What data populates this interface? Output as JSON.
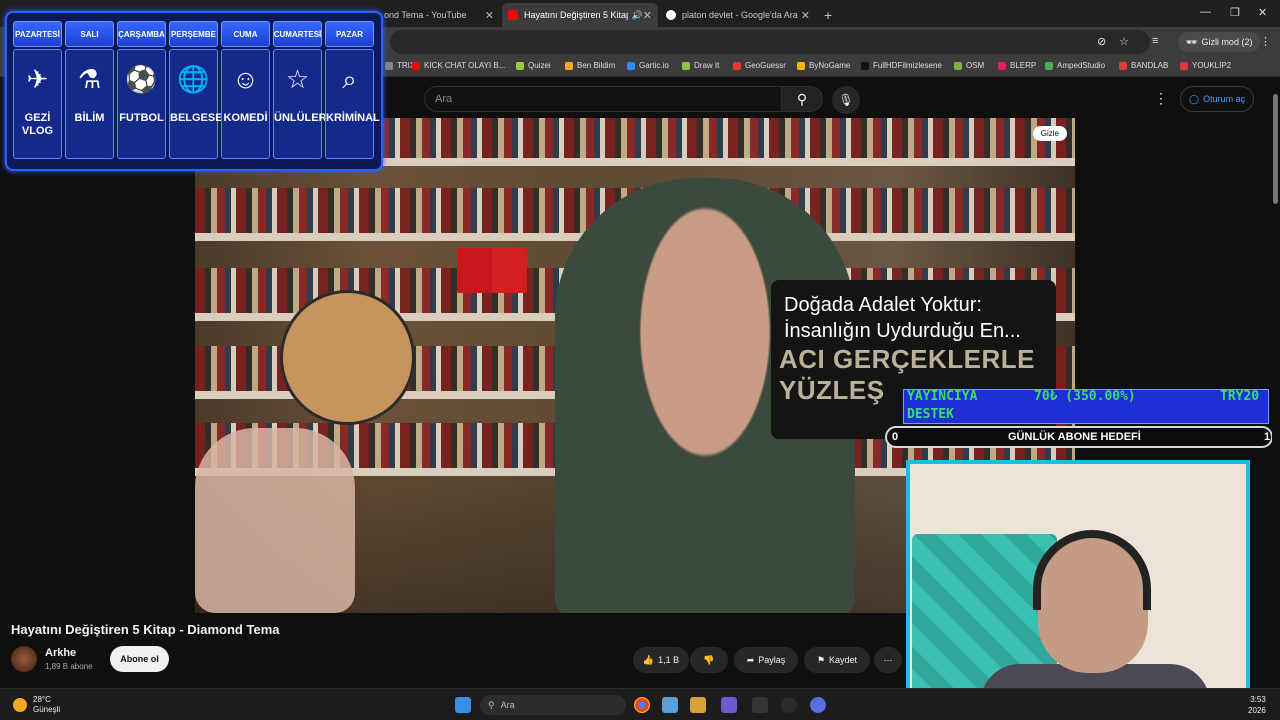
{
  "browser": {
    "tabs": [
      {
        "title": "ond Tema - YouTube",
        "active": false
      },
      {
        "title": "Hayatını Değiştiren 5 Kitap",
        "active": true
      },
      {
        "title": "platon devlet - Google'da Ara",
        "active": false
      }
    ],
    "new_tab_symbol": "+",
    "incognito_label": "Gizli mod (2)",
    "bookmarks": [
      {
        "label": "TRIX",
        "color": "#888888"
      },
      {
        "label": "KICK CHAT OLAYI B...",
        "color": "#ff0000"
      },
      {
        "label": "Quizei",
        "color": "#9acd32"
      },
      {
        "label": "Ben Bildim",
        "color": "#f5a623"
      },
      {
        "label": "Gartic.io",
        "color": "#2d8cff"
      },
      {
        "label": "Draw It",
        "color": "#8bc34a"
      },
      {
        "label": "GeoGuessr",
        "color": "#e53935"
      },
      {
        "label": "ByNoGame",
        "color": "#ffb300"
      },
      {
        "label": "FullHDFilmizlesene",
        "color": "#111111"
      },
      {
        "label": "OSM",
        "color": "#7cb342"
      },
      {
        "label": "BLERP",
        "color": "#e91e63"
      },
      {
        "label": "AmpedStudio",
        "color": "#4caf50"
      },
      {
        "label": "BANDLAB",
        "color": "#e53935"
      },
      {
        "label": "YOUKLİP2",
        "color": "#e53935"
      }
    ]
  },
  "youtube": {
    "search_placeholder": "Ara",
    "signin_label": "Oturum aç",
    "hide_label": "Gizle",
    "video_title": "Hayatını Değiştiren 5 Kitap - Diamond Tema",
    "channel_name": "Arkhe",
    "subscriber_count": "1,89 B abone",
    "subscribe_label": "Abone ol",
    "like_count": "1,1 B",
    "share_label": "Paylaş",
    "save_label": "Kaydet"
  },
  "stream_overlay": {
    "news_title": "Doğada Adalet Yoktur: İnsanlığın Uydurduğu En...",
    "news_subtitle": "ACI GERÇEKLERLE YÜZLEŞ",
    "donation": {
      "label_line1": "YAYINCIYA",
      "label_line2": "DESTEK",
      "amount": "70₺ (350.00%)",
      "goal": "TRY20"
    },
    "sub_goal": {
      "label": "GÜNLÜK ABONE HEDEFİ",
      "current": "0",
      "target": "1"
    },
    "schedule": [
      {
        "day": "PAZARTESİ",
        "topic": "GEZİ VLOG",
        "icon": "globe-plane-icon",
        "glyph": "✈"
      },
      {
        "day": "SALI",
        "topic": "BİLİM",
        "icon": "science-icon",
        "glyph": "⚗"
      },
      {
        "day": "ÇARŞAMBA",
        "topic": "FUTBOL",
        "icon": "football-icon",
        "glyph": "⚽"
      },
      {
        "day": "PERŞEMBE",
        "topic": "BELGESEL",
        "icon": "globe-icon",
        "glyph": "🌐"
      },
      {
        "day": "CUMA",
        "topic": "KOMEDİ",
        "icon": "theater-mask-icon",
        "glyph": "☺"
      },
      {
        "day": "CUMARTESİ",
        "topic": "ÜNLÜLER",
        "icon": "star-icon",
        "glyph": "☆"
      },
      {
        "day": "PAZAR",
        "topic": "KRİMİNAL",
        "icon": "fingerprint-search-icon",
        "glyph": "⌕"
      }
    ]
  },
  "taskbar": {
    "weather_temp": "28°C",
    "weather_desc": "Güneşli",
    "search_placeholder": "Ara",
    "time": "3:53",
    "date": "2026"
  }
}
